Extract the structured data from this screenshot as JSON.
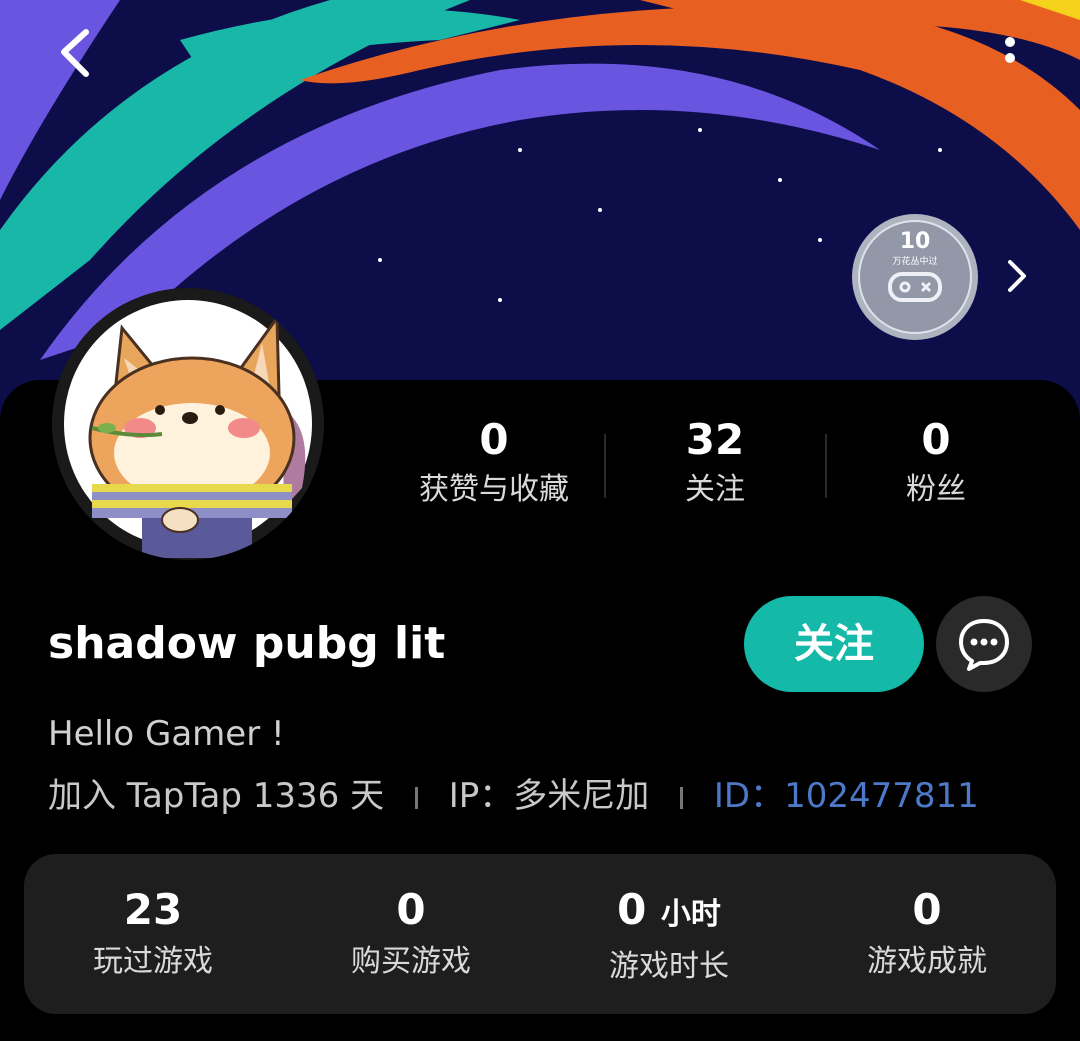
{
  "header": {
    "badge_level": "10",
    "badge_title": "万花丛中过"
  },
  "stats": [
    {
      "value": "0",
      "label": "获赞与收藏"
    },
    {
      "value": "32",
      "label": "关注"
    },
    {
      "value": "0",
      "label": "粉丝"
    }
  ],
  "profile": {
    "username": "shadow pubg lit",
    "follow_label": "关注",
    "bio": "Hello Gamer !",
    "joined": "加入 TapTap 1336 天",
    "ip": "IP：多米尼加",
    "id": "ID：102477811"
  },
  "games": [
    {
      "value": "23",
      "unit": "",
      "label": "玩过游戏"
    },
    {
      "value": "0",
      "unit": "",
      "label": "购买游戏"
    },
    {
      "value": "0",
      "unit": "小时",
      "label": "游戏时长"
    },
    {
      "value": "0",
      "unit": "",
      "label": "游戏成就"
    }
  ],
  "colors": {
    "accent": "#14b9a8",
    "id_link": "#4d79c9",
    "banner_bg": "#0d0d4a"
  },
  "icons": {
    "back": "chevron-left-icon",
    "more": "more-vertical-icon",
    "message": "chat-bubble-icon",
    "badge_arrow": "chevron-right-icon"
  }
}
